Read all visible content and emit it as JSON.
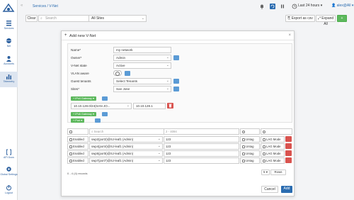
{
  "breadcrumb": "Services / V-Net",
  "topbar": {
    "timerange": "Last 24 hours",
    "user": "alex@All"
  },
  "sidebar": {
    "items": [
      {
        "label": "Services"
      },
      {
        "label": "Net"
      },
      {
        "label": "Accounts"
      },
      {
        "label": "Telemetry"
      },
      {
        "label": "API Docs"
      },
      {
        "label": "Global Settings"
      },
      {
        "label": "Logout"
      }
    ]
  },
  "filterbar": {
    "clear_label": "Clear",
    "search_placeholder": "Search",
    "sites_value": "All Sites",
    "export_label": "Export as csv",
    "expand_label": "Expand All",
    "add_label": "Add"
  },
  "modal": {
    "title": "Add new V-Net",
    "fields": {
      "name_label": "Name*",
      "name_value": "my network",
      "owner_label": "Owner*",
      "owner_value": "Admin",
      "state_label": "V-Net state",
      "state_value": "Active",
      "vlan_label": "VLAN aware",
      "guest_label": "Guest tenants",
      "guest_value": "Select Tenants",
      "sites_label": "Sites*",
      "sites_value": "San Jose"
    },
    "ipv4_gateway_label": "IPv4 Gateway",
    "gateway_row": {
      "subnet": "10.10.128.0/24(SAN JO...",
      "gateway": "10.10.128.1"
    },
    "ipv6_gateway_label": "IPv6 Gateway",
    "port_label": "Port",
    "port_table": {
      "search_placeholder": "Search",
      "vlan_placeholder": "2 - 4094",
      "rows": [
        {
          "enabled": "Enabled",
          "port": "swp2(port2)@SJ-leaf1 (Admin)",
          "vlan": "123",
          "untag": "Untag",
          "lag": "LAG Mode"
        },
        {
          "enabled": "Enabled",
          "port": "swp4(port4)@SJ-leaf1 (Admin)",
          "vlan": "123",
          "untag": "Untag",
          "lag": "LAG Mode"
        },
        {
          "enabled": "Enabled",
          "port": "swp5(port5)@SJ-leaf1 (Admin)",
          "vlan": "123",
          "untag": "Untag",
          "lag": "LAG Mode"
        },
        {
          "enabled": "Enabled",
          "port": "swp7(port7)@SJ-leaf1 (Admin)",
          "vlan": "123",
          "untag": "Untag",
          "lag": "LAG Mode"
        }
      ],
      "records": "0 - 4 (4) records",
      "page_size": "5",
      "rows_label": "Rows"
    },
    "cancel_label": "Cancel",
    "add_label": "Add"
  },
  "colors": {
    "accent": "#2b6cb0",
    "green": "#5cb85c",
    "red": "#d9534f",
    "info": "#5b9bd5"
  }
}
